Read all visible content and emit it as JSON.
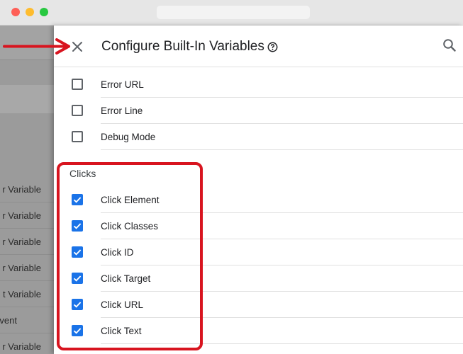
{
  "panel": {
    "title": "Configure Built-In Variables",
    "help_icon": "help-circle-icon",
    "close_icon": "close-icon",
    "search_icon": "search-icon"
  },
  "background_list": {
    "items": [
      "r Variable",
      "r Variable",
      "r Variable",
      "r Variable",
      "t Variable",
      "vent",
      "r Variable"
    ]
  },
  "error_rows": [
    {
      "label": "Error URL",
      "checked": false
    },
    {
      "label": "Error Line",
      "checked": false
    },
    {
      "label": "Debug Mode",
      "checked": false
    }
  ],
  "clicks_section": {
    "heading": "Clicks",
    "rows": [
      {
        "label": "Click Element",
        "checked": true
      },
      {
        "label": "Click Classes",
        "checked": true
      },
      {
        "label": "Click ID",
        "checked": true
      },
      {
        "label": "Click Target",
        "checked": true
      },
      {
        "label": "Click URL",
        "checked": true
      },
      {
        "label": "Click Text",
        "checked": true
      }
    ]
  },
  "colors": {
    "accent": "#1a73e8",
    "annotation_red": "#d8141f"
  }
}
